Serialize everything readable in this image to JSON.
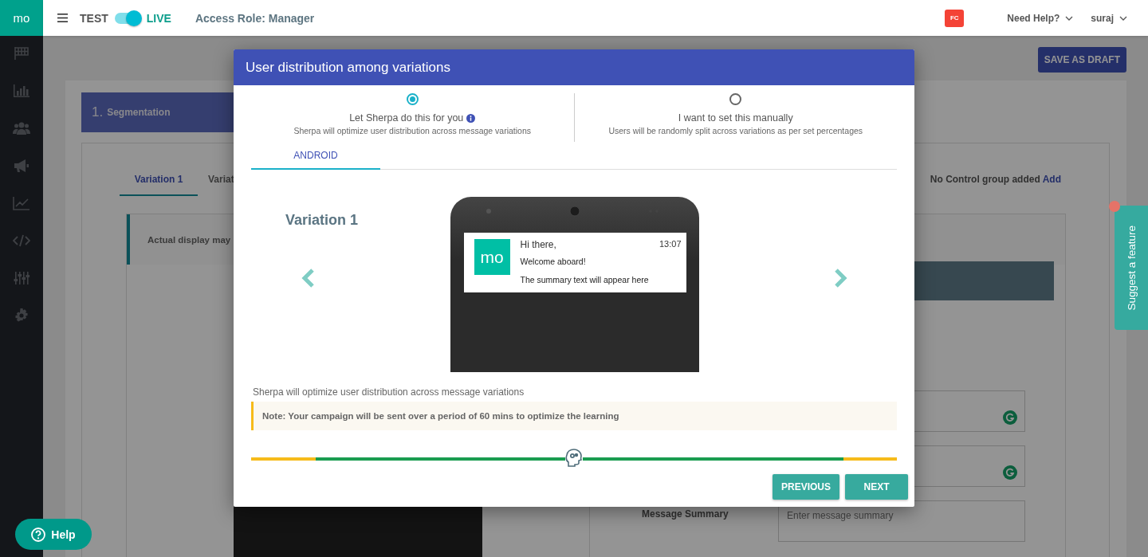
{
  "topbar": {
    "logo": "mo",
    "mode_toggle": {
      "off_label": "TEST",
      "on_label": "LIVE",
      "on": true
    },
    "access_role": "Access Role: Manager",
    "badge": "FC",
    "menus": [
      {
        "label": "Need Help?"
      },
      {
        "label": "suraj"
      }
    ]
  },
  "save_button": "SAVE AS DRAFT",
  "step": {
    "number": "1.",
    "label": "Segmentation"
  },
  "variation_tabs": [
    {
      "label": "Variation 1",
      "selected": true
    },
    {
      "label": "Variat",
      "selected": false
    }
  ],
  "control_group": {
    "text": "No Control group added",
    "link": "Add"
  },
  "preview_note": "Actual display may",
  "form": {
    "fields": [
      {
        "grammar_icon": true
      },
      {
        "grammar_icon": true
      },
      {
        "label": "Message Summary",
        "placeholder": "Enter message summary"
      }
    ]
  },
  "modal": {
    "title": "User distribution among variations",
    "options": [
      {
        "label": "Let Sherpa do this for you",
        "info": true,
        "description": "Sherpa will optimize user distribution across message variations",
        "selected": true
      },
      {
        "label": "I want to set this manually",
        "description": "Users will be randomly split across variations as per set percentages",
        "selected": false
      }
    ],
    "platform_tabs": [
      {
        "label": "ANDROID",
        "selected": true
      }
    ],
    "preview": {
      "heading": "Variation 1",
      "notification": {
        "logo": "mo",
        "title": "Hi there,",
        "time": "13:07",
        "message": "Welcome aboard!",
        "summary": "The summary text will appear here"
      }
    },
    "hint": "Sherpa will optimize user distribution across message variations",
    "note": "Note: Your campaign will be sent over a period of 60 mins to optimize the learning",
    "slider": {
      "level": 0.5
    },
    "buttons": [
      {
        "label": "PREVIOUS"
      },
      {
        "label": "NEXT"
      }
    ]
  },
  "help_button": "Help",
  "feature_tab": {
    "label": "Suggest a feature",
    "dot": true
  }
}
